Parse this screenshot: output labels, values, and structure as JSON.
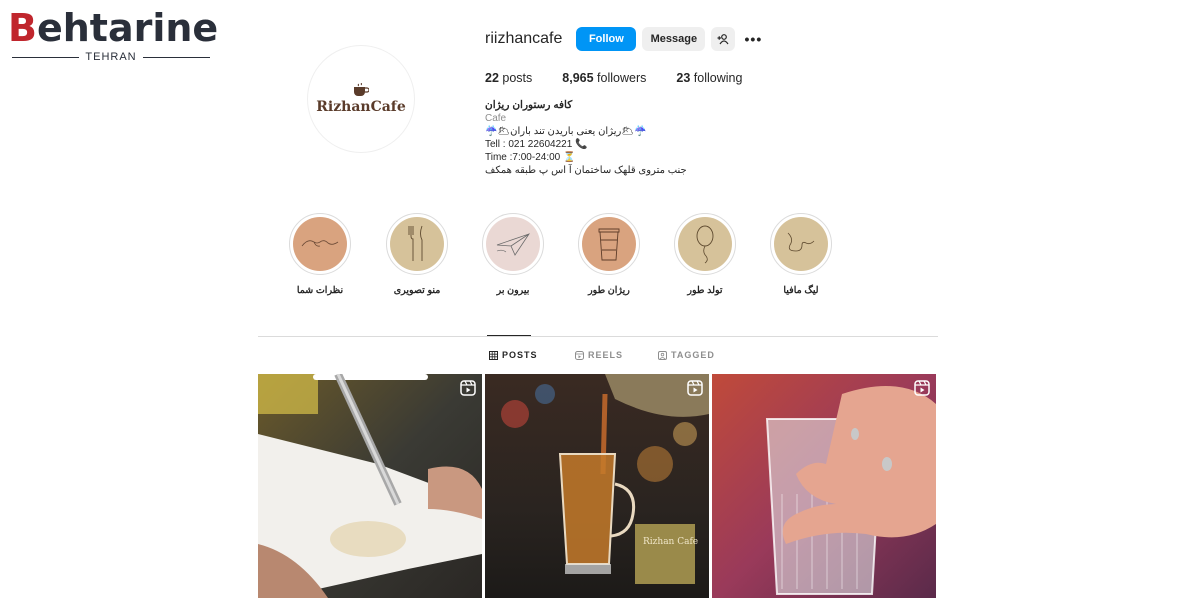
{
  "watermark": {
    "word_initial": "B",
    "word_rest": "ehtarine",
    "subtitle": "TEHRAN"
  },
  "avatar": {
    "brand": "RizhanCafe"
  },
  "header": {
    "username": "riizhancafe",
    "follow_label": "Follow",
    "message_label": "Message",
    "more_label": "•••"
  },
  "stats": {
    "posts_count": "22",
    "posts_label": "posts",
    "followers_count": "8,965",
    "followers_label": "followers",
    "following_count": "23",
    "following_label": "following"
  },
  "bio": {
    "name": "کافه رستوران ریژان",
    "category": "Cafe",
    "line1": "☔🌥ریژان یعنی باریدن تند باران🌥☔",
    "line2": "Tell : 021 22604221 📞",
    "line3": "Time :7:00-24:00 ⏳",
    "line4": "جنب متروی قلهک ساختمان آ اس پ طبقه همکف"
  },
  "highlights": [
    {
      "label": "نظرات شما",
      "icon": "handshake-icon",
      "color": "#d9a37f"
    },
    {
      "label": "منو تصویری",
      "icon": "cutlery-icon",
      "color": "#d6c29a"
    },
    {
      "label": "بیرون بر",
      "icon": "paper-plane-icon",
      "color": "#ead8d4"
    },
    {
      "label": "ریژان طور",
      "icon": "coffee-cup-icon",
      "color": "#d9a37f"
    },
    {
      "label": "تولد طور",
      "icon": "balloon-icon",
      "color": "#d6c29a"
    },
    {
      "label": "لیگ مافیا",
      "icon": "squiggle-icon",
      "color": "#d6c29a"
    }
  ],
  "tabs": {
    "posts": "POSTS",
    "reels": "REELS",
    "tagged": "TAGGED"
  },
  "posts": [
    {
      "icon": "reel-icon"
    },
    {
      "icon": "reel-icon",
      "packaging_text": "Rizhan Cafe"
    },
    {
      "icon": "reel-icon"
    }
  ],
  "colors": {
    "accent": "#0095f6",
    "text": "#262626",
    "muted": "#8e8e8e",
    "border": "#dbdbdb"
  }
}
